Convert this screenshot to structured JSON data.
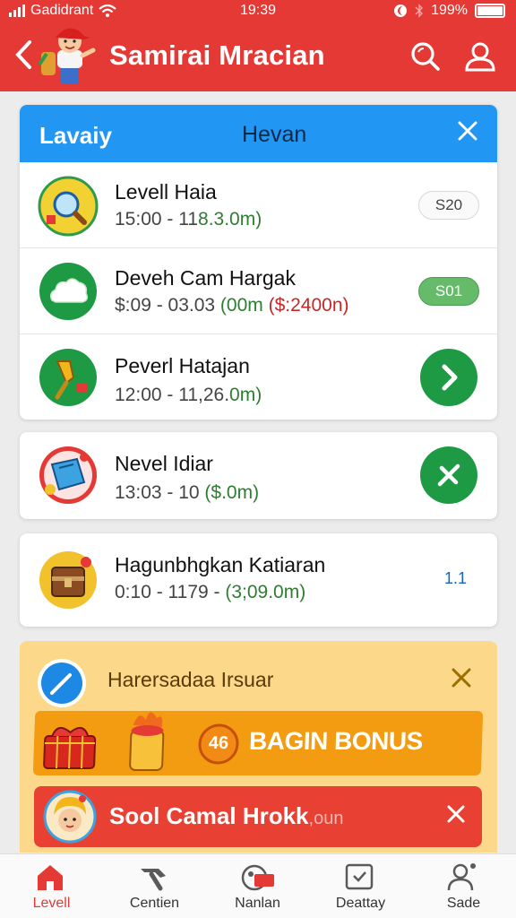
{
  "status_bar": {
    "carrier": "Gadidrant",
    "time": "19:39",
    "battery": "199%"
  },
  "header": {
    "title": "Samirai Mracian"
  },
  "main_card": {
    "tab_left": "Lavaiy",
    "tab_center": "Hevan",
    "rows": [
      {
        "name": "Levell Haia",
        "time_prefix": "15:00 - 11",
        "time_green": "8.3.0m)",
        "time_red": "",
        "action": "S20"
      },
      {
        "name": "Deveh Cam Hargak",
        "time_prefix": "$:09 - 03.03 ",
        "time_green": "(00m",
        "time_red": "($:2400n)",
        "action": "S01"
      },
      {
        "name": "Peverl Hatajan",
        "time_prefix": "12:00 - 11,26.",
        "time_green": "0m)",
        "time_red": "",
        "action_icon": "chevron-right-icon"
      }
    ]
  },
  "card2": {
    "name": "Nevel Idiar",
    "time_prefix": "13:03 - 10 ",
    "time_green": "($.0m)",
    "action_icon": "cross-icon"
  },
  "card3": {
    "name": "Hagunbhgkan Katiaran",
    "time_prefix": "0:10 - 1179 - ",
    "time_green": "(3;09.0m)",
    "action": "1.1"
  },
  "promo": {
    "title": "Harersadaa Irsuar",
    "bonus_number": "46",
    "bonus_text": "BAGIN BONUS",
    "red_text": "Sool Camal Hrokk",
    "red_suffix": ",oun"
  },
  "bottom_nav": [
    {
      "label": "Levell",
      "active": true
    },
    {
      "label": "Centien",
      "active": false
    },
    {
      "label": "Nanlan",
      "active": false
    },
    {
      "label": "Deattay",
      "active": false
    },
    {
      "label": "Sade",
      "active": false
    }
  ],
  "colors": {
    "header_red": "#e53935",
    "tab_blue": "#2196f3",
    "success_green": "#1e9a45",
    "promo_yellow": "#fcd98a",
    "bonus_orange": "#f39c12"
  }
}
